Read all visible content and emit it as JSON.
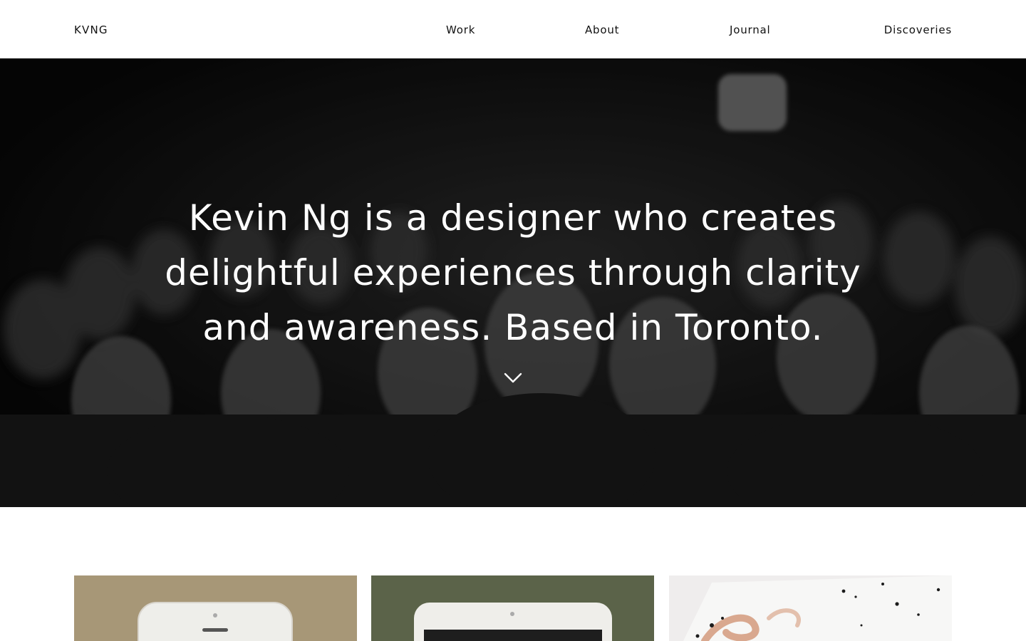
{
  "header": {
    "brand": "KVNG",
    "nav": [
      "Work",
      "About",
      "Journal",
      "Discoveries"
    ]
  },
  "hero": {
    "headline_lines": [
      "Kevin Ng is a designer who creates",
      "delightful experiences through clarity",
      "and awareness. Based in Toronto."
    ],
    "scroll_icon": "chevron-down-icon"
  },
  "projects": [
    {
      "image": "white-phone-on-tan-background",
      "color": "#a79777"
    },
    {
      "image": "white-phone-on-olive-background",
      "color": "#5b6349"
    },
    {
      "image": "paint-splatter-artwork",
      "color": "#efeded"
    }
  ],
  "colors": {
    "text": "#111111",
    "background": "#ffffff",
    "hero_overlay": "#0b0b0b",
    "hero_text": "#ffffff"
  }
}
